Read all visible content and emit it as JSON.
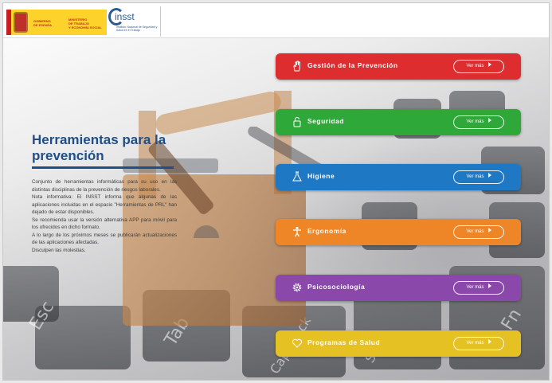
{
  "header": {
    "gov_logo": {
      "gobierno": "GOBIERNO\nDE ESPAÑA",
      "ministerio": "MINISTERIO\nDE TRABAJO\nY ECONOMÍA SOCIAL"
    },
    "insst_logo": {
      "name": "insst",
      "subtitle": "Instituto Nacional de Seguridad y Salud en el Trabajo"
    }
  },
  "intro": {
    "title": "Herramientas para la prevención",
    "paragraphs": [
      "Conjunto de herramientas informáticas para su uso en las distintas disciplinas de la prevención de riesgos laborales.",
      "Nota informativa: El INSST informa que algunas de las aplicaciones incluidas en el espacio \"Herramientas de PRL\" han dejado de estar disponibles.",
      "Se recomienda usar la versión alternativa APP para móvil para los ofrecidos en dicho formato.",
      "A lo largo de los próximos meses se publicarán actualizaciones de las aplicaciones afectadas.",
      "Disculpen las molestias."
    ]
  },
  "categories": [
    {
      "label": "Gestión de la Prevención",
      "button": "Ver más",
      "color": "#dd2d2f",
      "icon": "hand-icon"
    },
    {
      "label": "Seguridad",
      "button": "Ver más",
      "color": "#2fa83a",
      "icon": "lock-icon"
    },
    {
      "label": "Higiene",
      "button": "Ver más",
      "color": "#1f78c4",
      "icon": "flask-icon"
    },
    {
      "label": "Ergonomía",
      "button": "Ver más",
      "color": "#ee8627",
      "icon": "person-icon"
    },
    {
      "label": "Psicosociología",
      "button": "Ver más",
      "color": "#8a48ab",
      "icon": "gear-icon"
    },
    {
      "label": "Programas de Salud",
      "button": "Ver más",
      "color": "#e5c123",
      "icon": "heart-icon"
    }
  ],
  "background": {
    "keys": [
      "Esc",
      "Tab",
      "Caps Lock",
      "Shift",
      "Fn"
    ]
  }
}
